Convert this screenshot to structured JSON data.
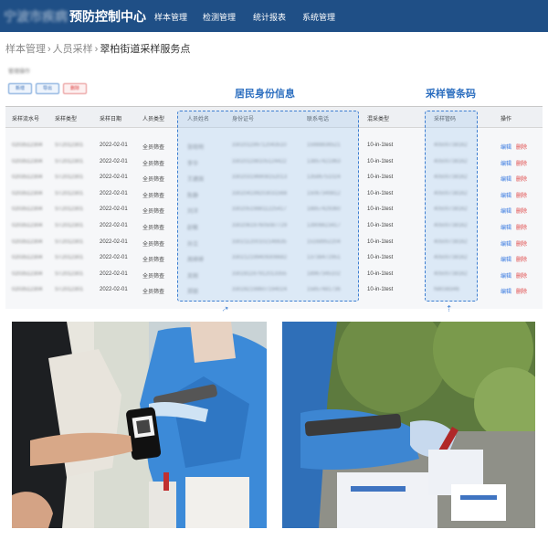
{
  "header": {
    "title_blurred": "宁波市疾病",
    "title": "预防控制中心",
    "nav": [
      "样本管理",
      "检测管理",
      "统计报表",
      "系统管理"
    ]
  },
  "breadcrumb": [
    "样本管理",
    "人员采样",
    "翠柏街道采样服务点"
  ],
  "toolbar": {
    "label": "管理操作",
    "buttons": [
      "新增",
      "导出",
      "删除"
    ]
  },
  "annotations": {
    "resident_info": "居民身份信息",
    "tube_barcode": "采样管条码"
  },
  "table": {
    "columns": [
      "采样流水号",
      "采样类型",
      "采样日期",
      "人员类型",
      "人员姓名",
      "身份证号",
      "联系电话",
      "混采类型",
      "采样管码",
      "操作"
    ],
    "rows": [
      {
        "serial": "0203512304",
        "type": "ST2012301",
        "date": "2022-02-01",
        "ptype": "全员筛查",
        "name": "张晓明",
        "id": "330201199712043510",
        "phone": "15988836521",
        "mix": "10-in-1test",
        "tube": "40500738162",
        "edit": "编辑",
        "del": "删除"
      },
      {
        "serial": "0203512304",
        "type": "ST2012301",
        "date": "2022-02-01",
        "ptype": "全员筛查",
        "name": "李华",
        "id": "330201198105124422",
        "phone": "13857421963",
        "mix": "10-in-1test",
        "tube": "40500738162",
        "edit": "编辑",
        "del": "删除"
      },
      {
        "serial": "0203512304",
        "type": "ST2012301",
        "date": "2022-02-01",
        "ptype": "全员筛查",
        "name": "王建国",
        "id": "330203196908152013",
        "phone": "13586751024",
        "mix": "10-in-1test",
        "tube": "40500738162",
        "edit": "编辑",
        "del": "删除"
      },
      {
        "serial": "0203512304",
        "type": "ST2012301",
        "date": "2022-02-01",
        "ptype": "全员筛查",
        "name": "陈静",
        "id": "330204199203031568",
        "phone": "15067349812",
        "mix": "10-in-1test",
        "tube": "40500738162",
        "edit": "编辑",
        "del": "删除"
      },
      {
        "serial": "0203512304",
        "type": "ST2012301",
        "date": "2022-02-01",
        "ptype": "全员筛查",
        "name": "刘洋",
        "id": "330205198811225417",
        "phone": "18857429360",
        "mix": "10-in-1test",
        "tube": "40500738162",
        "edit": "编辑",
        "del": "删除"
      },
      {
        "serial": "0203512304",
        "type": "ST2012301",
        "date": "2022-02-01",
        "ptype": "全员筛查",
        "name": "赵敏",
        "id": "330206197605087729",
        "phone": "13906623417",
        "mix": "10-in-1test",
        "tube": "40500738162",
        "edit": "编辑",
        "del": "删除"
      },
      {
        "serial": "0203512304",
        "type": "ST2012301",
        "date": "2022-02-01",
        "ptype": "全员筛查",
        "name": "孙立",
        "id": "330211200102146635",
        "phone": "15168952204",
        "mix": "10-in-1test",
        "tube": "40500738162",
        "edit": "编辑",
        "del": "删除"
      },
      {
        "serial": "0203512304",
        "type": "ST2012301",
        "date": "2022-02-01",
        "ptype": "全员筛查",
        "name": "周婷婷",
        "id": "330212199409306682",
        "phone": "13738472951",
        "mix": "10-in-1test",
        "tube": "40500738162",
        "edit": "编辑",
        "del": "删除"
      },
      {
        "serial": "0203512304",
        "type": "ST2012301",
        "date": "2022-02-01",
        "ptype": "全员筛查",
        "name": "吴刚",
        "id": "330281197912013355",
        "phone": "18967345102",
        "mix": "10-in-1test",
        "tube": "40500738162",
        "edit": "编辑",
        "del": "删除"
      },
      {
        "serial": "0203512304",
        "type": "ST2012301",
        "date": "2022-02-01",
        "ptype": "全员筛查",
        "name": "郑丽",
        "id": "330282198607194024",
        "phone": "15857481736",
        "mix": "10-in-1test",
        "tube": "N8038346",
        "edit": "编辑",
        "del": "删除"
      }
    ]
  },
  "colors": {
    "header_bg": "#1f4f86",
    "accent": "#2d6fc0",
    "highlight_box": "#acCDF0",
    "danger": "#e04848"
  }
}
